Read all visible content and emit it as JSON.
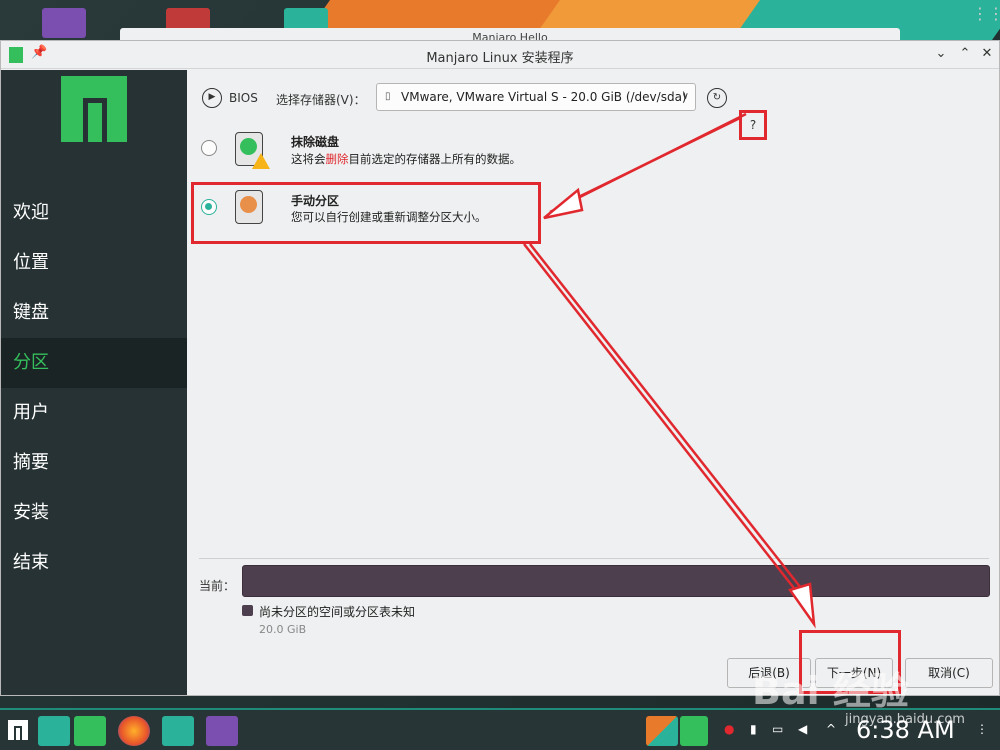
{
  "desktop": {
    "hello_window_title": "Manjaro Hello"
  },
  "window": {
    "title": "Manjaro Linux 安装程序"
  },
  "sidebar": {
    "items": [
      {
        "label": "欢迎",
        "active": false
      },
      {
        "label": "位置",
        "active": false
      },
      {
        "label": "键盘",
        "active": false
      },
      {
        "label": "分区",
        "active": true
      },
      {
        "label": "用户",
        "active": false
      },
      {
        "label": "摘要",
        "active": false
      },
      {
        "label": "安装",
        "active": false
      },
      {
        "label": "结束",
        "active": false
      }
    ]
  },
  "main": {
    "bios_label": "BIOS",
    "storage_label": "选择存储器(V)：",
    "storage_value": "VMware, VMware Virtual S - 20.0 GiB (/dev/sda)",
    "help_label": "?",
    "options": {
      "erase": {
        "title": "抹除磁盘",
        "desc_before": "这将会",
        "desc_highlight": "删除",
        "desc_after": "目前选定的存储器上所有的数据。"
      },
      "manual": {
        "title": "手动分区",
        "desc": "您可以自行创建或重新调整分区大小。"
      }
    },
    "current_label": "当前：",
    "legend": {
      "text": "尚未分区的空间或分区表未知",
      "size": "20.0 GiB"
    },
    "buttons": {
      "back": "后退(B)",
      "next": "下一步(N)",
      "cancel": "取消(C)"
    }
  },
  "taskbar": {
    "clock": "6:38 AM"
  },
  "watermark": {
    "text": "Bai 经验",
    "url": "jingyan.baidu.com"
  },
  "colors": {
    "accent": "#35bf5c",
    "teal": "#2ab39a",
    "annotation_red": "#e0282e",
    "sidebar_bg": "#263233",
    "partition_bar": "#4d3f4e"
  }
}
